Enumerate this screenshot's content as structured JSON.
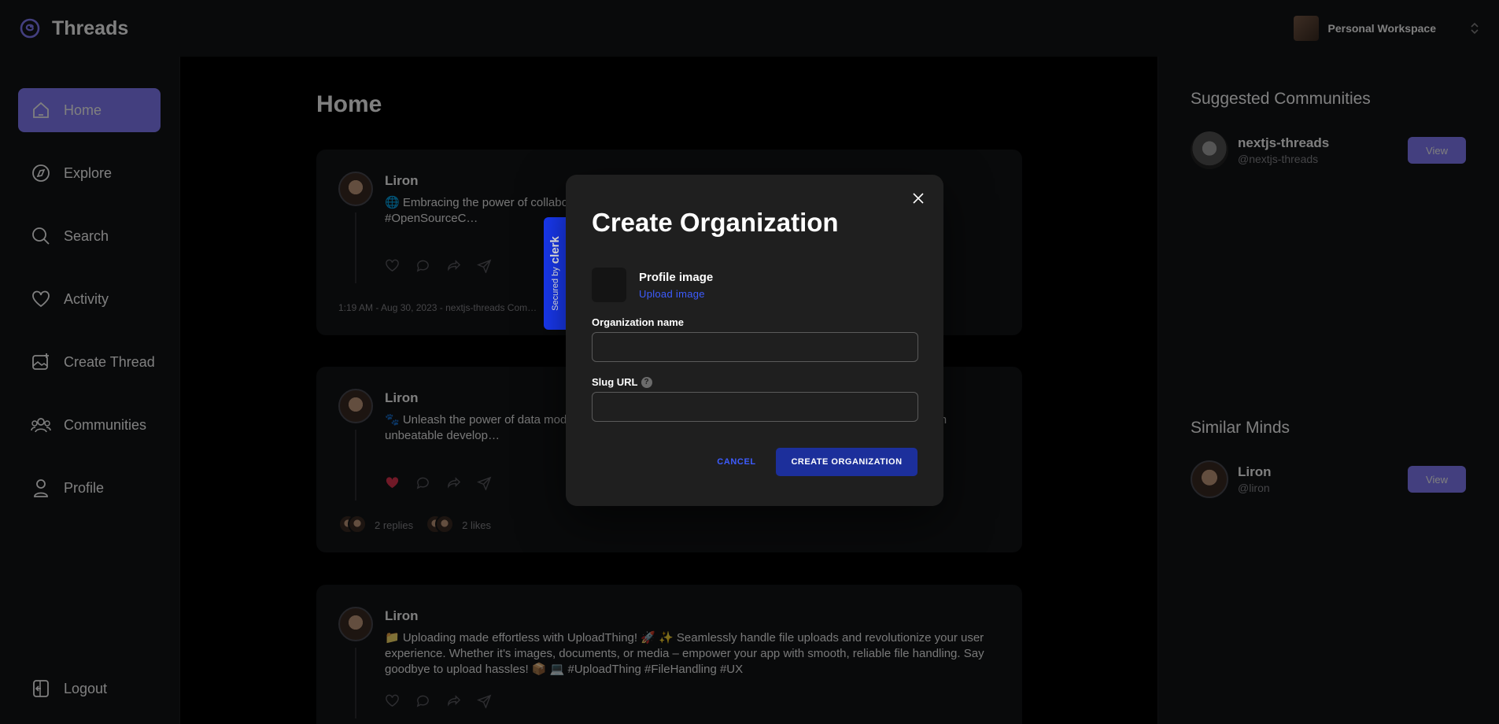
{
  "app": {
    "name": "Threads"
  },
  "workspace": {
    "name": "Personal Workspace"
  },
  "nav": {
    "items": [
      {
        "label": "Home",
        "icon": "home-icon"
      },
      {
        "label": "Explore",
        "icon": "compass-icon"
      },
      {
        "label": "Search",
        "icon": "search-icon"
      },
      {
        "label": "Activity",
        "icon": "heart-icon"
      },
      {
        "label": "Create Thread",
        "icon": "image-plus-icon"
      },
      {
        "label": "Communities",
        "icon": "users-icon"
      },
      {
        "label": "Profile",
        "icon": "user-icon"
      }
    ],
    "logout": "Logout"
  },
  "main": {
    "title": "Home",
    "posts": [
      {
        "author": "Liron",
        "text": "🌐 Embracing the power of collabo… e way for a world where knowledge know… 💡 📚 #TechForGood #OpenSourceC…",
        "meta": "1:19 AM - Aug 30, 2023 - nextjs-threads Com…"
      },
      {
        "author": "Liron",
        "text": "🐾 Unleash the power of data mod… ongoDB databases, making complex tasks a… nes the process for an unbeatable develop…",
        "replies": "2 replies",
        "likes": "2 likes"
      },
      {
        "author": "Liron",
        "text": "📁 Uploading made effortless with UploadThing! 🚀 ✨ Seamlessly handle file uploads and revolutionize your user experience. Whether it's images, documents, or media – empower your app with smooth, reliable file handling. Say goodbye to upload hassles! 📦 💻 #UploadThing #FileHandling #UX"
      }
    ]
  },
  "right": {
    "communities_title": "Suggested Communities",
    "communities": [
      {
        "name": "nextjs-threads",
        "handle": "@nextjs-threads",
        "button": "View"
      }
    ],
    "minds_title": "Similar Minds",
    "minds": [
      {
        "name": "Liron",
        "handle": "@liron",
        "button": "View"
      }
    ]
  },
  "modal": {
    "title": "Create Organization",
    "profile_image_label": "Profile image",
    "upload_label": "Upload image",
    "org_name_label": "Organization name",
    "org_name_value": "",
    "slug_label": "Slug URL",
    "slug_help": "?",
    "slug_value": "",
    "cancel": "CANCEL",
    "create": "CREATE ORGANIZATION"
  },
  "clerk_badge": {
    "prefix": "Secured by",
    "brand": "clerk"
  },
  "colors": {
    "accent": "#877eff",
    "primary_button": "#1c2f9b",
    "link": "#3d5cff",
    "badge": "#1a3cff"
  }
}
